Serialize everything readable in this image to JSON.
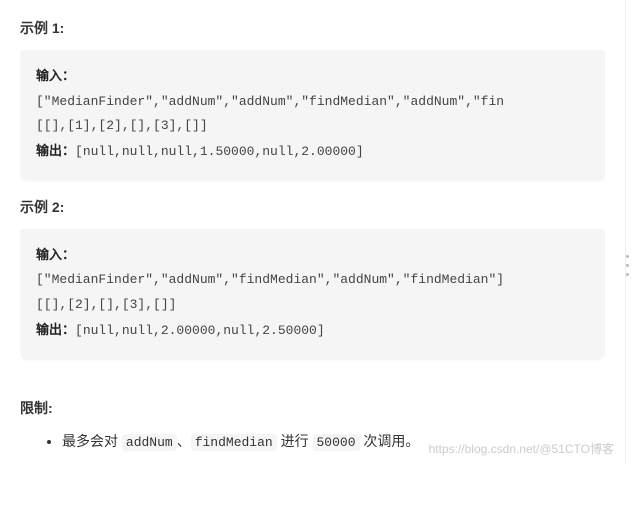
{
  "example1": {
    "title": "示例 1:",
    "input_label": "输入：",
    "input_line1": "[\"MedianFinder\",\"addNum\",\"addNum\",\"findMedian\",\"addNum\",\"fin",
    "input_line2": "[[],[1],[2],[],[3],[]]",
    "output_label": "输出：",
    "output_value": "[null,null,null,1.50000,null,2.00000]"
  },
  "example2": {
    "title": "示例 2:",
    "input_label": "输入：",
    "input_line1": "[\"MedianFinder\",\"addNum\",\"findMedian\",\"addNum\",\"findMedian\"]",
    "input_line2": "[[],[2],[],[3],[]]",
    "output_label": "输出：",
    "output_value": "[null,null,2.00000,null,2.50000]"
  },
  "limits": {
    "title": "限制:",
    "item_prefix": "最多会对 ",
    "code1": "addNum",
    "sep": "、",
    "code2": "findMedian",
    "mid": " 进行 ",
    "code3": "50000",
    "suffix": " 次调用。"
  },
  "watermark": "https://blog.csdn.net/@51CTO博客"
}
